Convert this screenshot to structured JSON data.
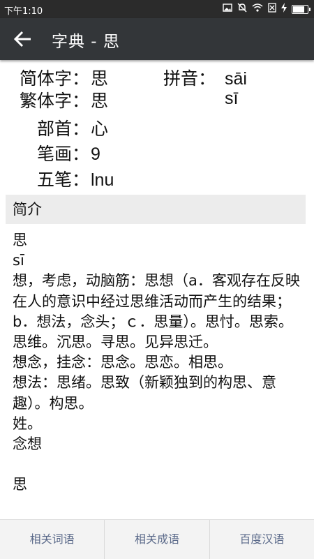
{
  "status_bar": {
    "time": "下午1:10",
    "icons": [
      "image-icon",
      "mute-icon",
      "wifi-icon",
      "sim-blocked-icon",
      "charging-icon",
      "battery-icon"
    ],
    "battery_level": 0.9
  },
  "app_bar": {
    "title": "字典 - 思"
  },
  "info": {
    "simplified_label": "简体字：",
    "simplified_value": "思",
    "pinyin_label": "拼音：",
    "pinyin_1": "sāi",
    "pinyin_2": "sī",
    "traditional_label": "繁体字：",
    "traditional_value": "思",
    "radical_label": "部首：",
    "radical_value": "心",
    "strokes_label": "笔画：",
    "strokes_value": "9",
    "wubi_label": "五笔：",
    "wubi_value": "lnu"
  },
  "section": {
    "title": "简介"
  },
  "content": {
    "text": "思\nsī\n想，考虑，动脑筋：思想（a．客观存在反映在人的意识中经过思维活动而产生的结果；b．想法，念头；ｃ．思量）。思忖。思索。思维。沉思。寻思。见异思迁。\n想念，挂念：思念。思恋。相思。\n想法：思绪。思致（新颖独到的构思、意趣）。构思。\n姓。\n念想\n\n思"
  },
  "bottom_bar": {
    "tab_1": "相关词语",
    "tab_2": "相关成语",
    "tab_3": "百度汉语"
  }
}
